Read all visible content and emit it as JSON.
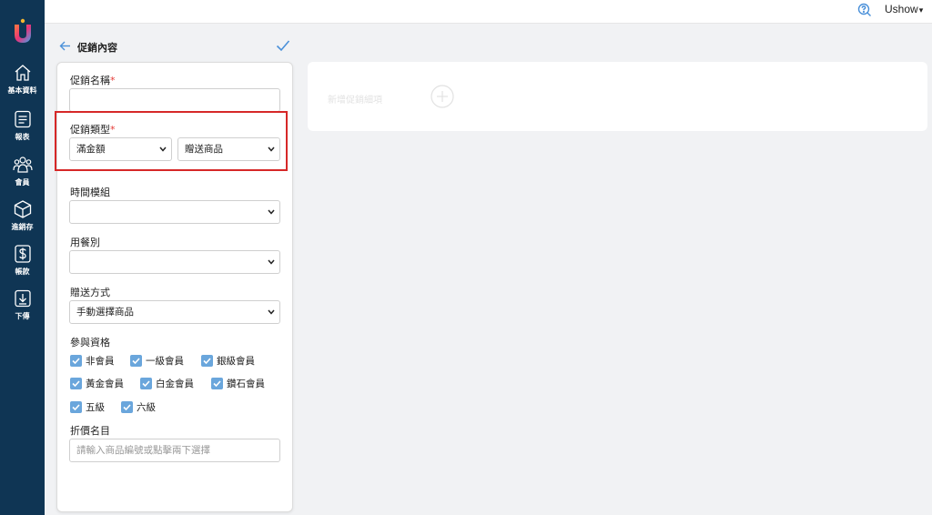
{
  "sidebar": {
    "items": [
      {
        "label": "基本資料",
        "icon": "home-icon"
      },
      {
        "label": "報表",
        "icon": "report-icon"
      },
      {
        "label": "會員",
        "icon": "members-icon"
      },
      {
        "label": "進銷存",
        "icon": "inventory-box-icon"
      },
      {
        "label": "帳款",
        "icon": "dollar-icon"
      },
      {
        "label": "下傳",
        "icon": "download-icon"
      }
    ]
  },
  "topbar": {
    "user_name": "Ushow",
    "caret": "▾"
  },
  "header": {
    "title": "促銷內容"
  },
  "form": {
    "promo_name": {
      "label": "促銷名稱",
      "required_mark": "*",
      "value": ""
    },
    "promo_type": {
      "label": "促銷類型",
      "required_mark": "*",
      "type_value": "滿金額",
      "reward_value": "贈送商品"
    },
    "time_module": {
      "label": "時間模組",
      "value": ""
    },
    "dining_type": {
      "label": "用餐別",
      "value": ""
    },
    "gift_method": {
      "label": "贈送方式",
      "value": "手動選擇商品"
    },
    "eligibility": {
      "label": "參與資格",
      "options": [
        {
          "label": "非會員",
          "checked": true
        },
        {
          "label": "一級會員",
          "checked": true
        },
        {
          "label": "銀級會員",
          "checked": true
        },
        {
          "label": "黃金會員",
          "checked": true
        },
        {
          "label": "白金會員",
          "checked": true
        },
        {
          "label": "鑽石會員",
          "checked": true
        },
        {
          "label": "五級",
          "checked": true
        },
        {
          "label": "六級",
          "checked": true
        }
      ]
    },
    "discount_items": {
      "label": "折價名目",
      "placeholder": "請輸入商品編號或點擊兩下選擇"
    }
  },
  "right_panel": {
    "add_detail_label": "新增促銷細項"
  },
  "colors": {
    "sidebar_bg": "#0f3554",
    "accent_blue": "#4a90d9",
    "checkbox_blue": "#6aa6dc",
    "highlight_red": "#d62828",
    "required_red": "#e53935"
  }
}
